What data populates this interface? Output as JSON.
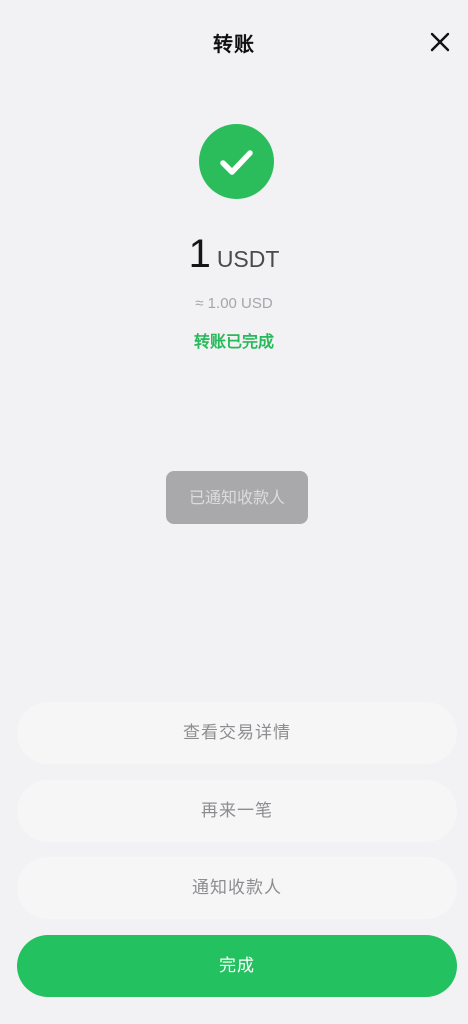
{
  "header": {
    "title": "转账",
    "close_icon": "close-icon"
  },
  "result": {
    "icon": "checkmark-icon",
    "icon_color": "#2bbd5c",
    "amount": "1",
    "unit": "USDT",
    "fiat_approx": "≈ 1.00 USD",
    "status": "转账已完成",
    "status_color": "#27ba5a"
  },
  "notified_badge": {
    "label": "已通知收款人"
  },
  "actions": {
    "view_details": "查看交易详情",
    "transfer_again": "再来一笔",
    "notify_payee": "通知收款人",
    "done": "完成",
    "done_color": "#23c15f"
  }
}
